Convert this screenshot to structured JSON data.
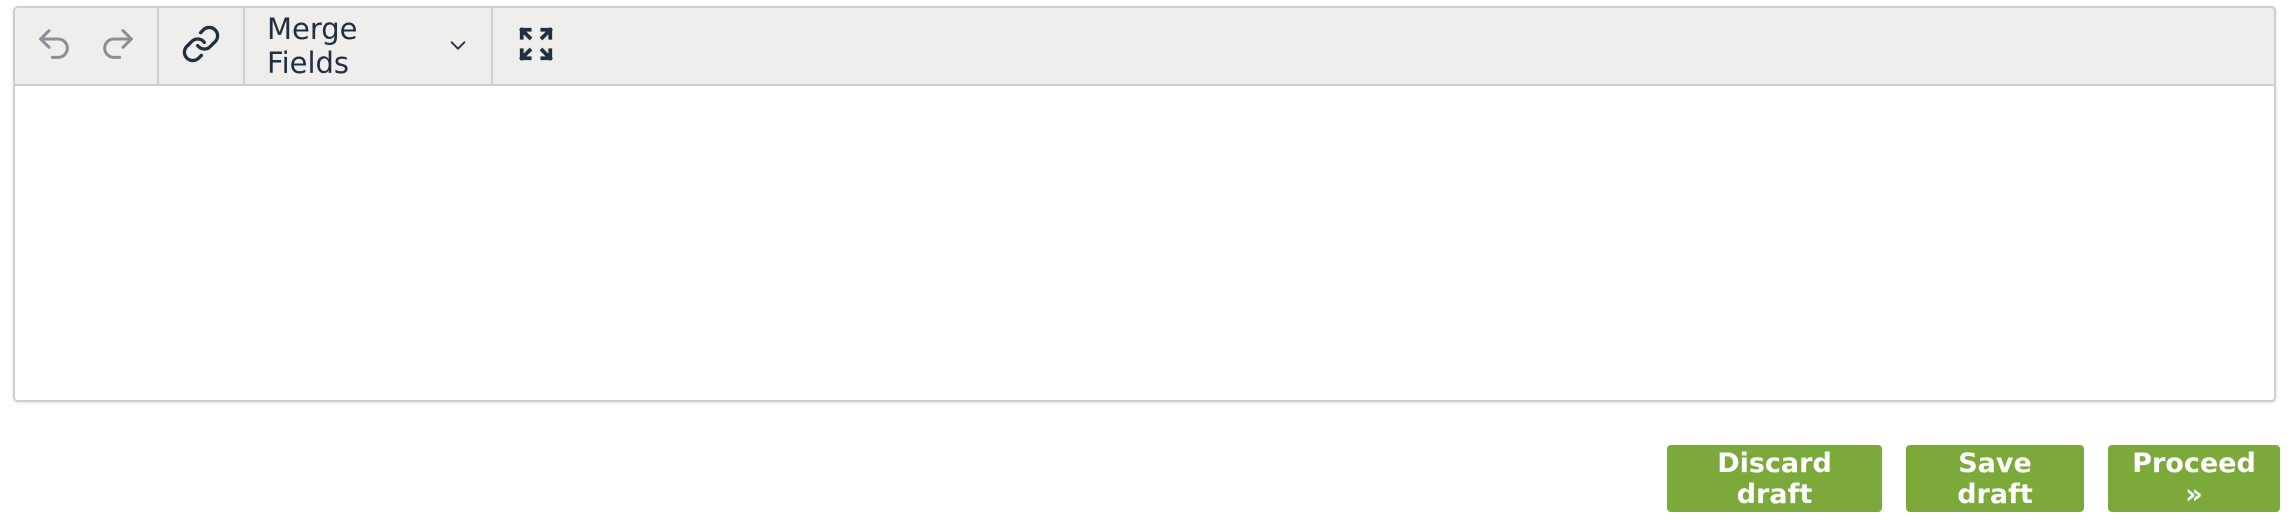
{
  "toolbar": {
    "undo_icon": "undo-icon",
    "redo_icon": "redo-icon",
    "link_icon": "link-icon",
    "merge_fields_label": "Merge Fields",
    "merge_fields_icon": "chevron-down-icon",
    "fullscreen_icon": "fullscreen-icon"
  },
  "editor": {
    "content": ""
  },
  "actions": {
    "discard_label": "Discard draft",
    "save_label": "Save draft",
    "proceed_label": "Proceed »"
  },
  "colors": {
    "button_green": "#7caa3a",
    "toolbar_bg": "#efeeec",
    "border": "#cfcfcf",
    "icon_dark": "#222f3e",
    "icon_disabled": "#8a8f96"
  }
}
